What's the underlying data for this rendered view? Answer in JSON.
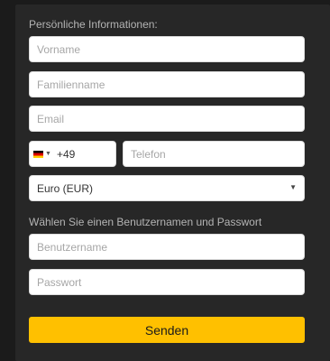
{
  "form": {
    "personal_heading": "Persönliche Informationen:",
    "firstname_placeholder": "Vorname",
    "lastname_placeholder": "Familienname",
    "email_placeholder": "Email",
    "phone": {
      "country_flag": "DE",
      "dial_code": "+49",
      "placeholder": "Telefon"
    },
    "currency": {
      "selected": "Euro (EUR)"
    },
    "account_heading": "Wählen Sie einen Benutzernamen und Passwort",
    "username_placeholder": "Benutzername",
    "password_placeholder": "Passwort",
    "submit_label": "Senden"
  },
  "colors": {
    "background": "#1b1b1b",
    "panel": "#272727",
    "accent": "#ffc000"
  }
}
